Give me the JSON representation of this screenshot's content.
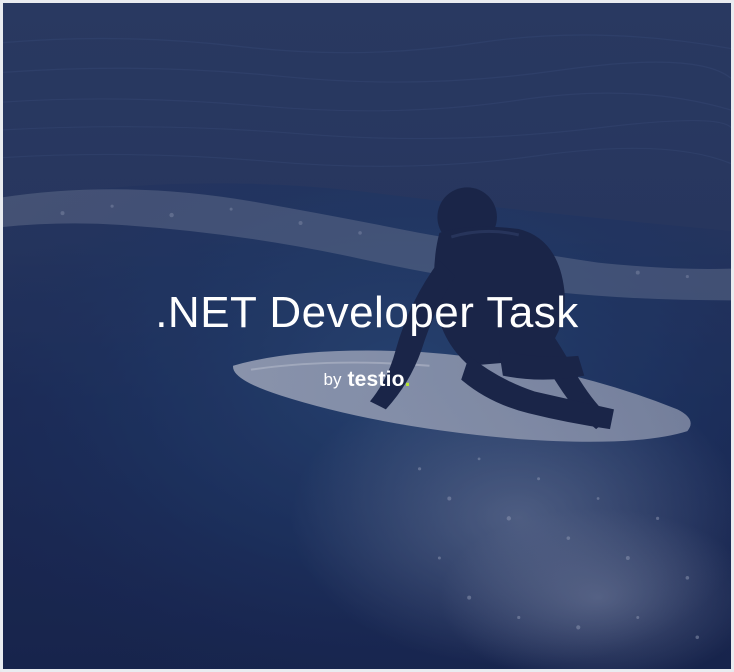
{
  "hero": {
    "title": ".NET Developer Task",
    "by_text": "by",
    "logo_text": "testio",
    "logo_dot": ".",
    "logo_dot_color": "#b6e432",
    "background_image": "surfer riding a wave on a white surfboard in dark blue ocean",
    "overlay_color": "#1a264e"
  }
}
